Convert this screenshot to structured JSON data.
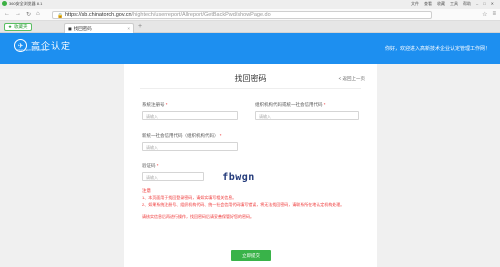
{
  "browser": {
    "window_title": "360安全浏览器 8.1",
    "menu": [
      "文件",
      "查看",
      "收藏",
      "工具",
      "帮助"
    ],
    "url_host": "https://sb.chinatorch.gov.cn",
    "url_path": "/hightech/userreport/Allreport/GetBackPwd/showPage.do",
    "favorites_label": "收藏夹",
    "tab_label": "找回密码"
  },
  "header": {
    "logo_text": "高企认定",
    "logo_sub": "HIGH-TECH ENTERPRISE",
    "welcome": "你好，欢迎进入高新技术企业认定管理工作网！"
  },
  "form": {
    "title": "找回密码",
    "back_link": "< 返回上一页",
    "fields": {
      "reg_no": {
        "label": "系统注册号",
        "placeholder": "请输入"
      },
      "org_code": {
        "label": "组织机构代码或统一社会信用代码",
        "placeholder": "请输入"
      },
      "new_code": {
        "label": "新统一社会信用代码（组织机构代码）",
        "placeholder": "请输入"
      },
      "captcha": {
        "label": "验证码",
        "placeholder": "请输入"
      }
    },
    "captcha_text": "fbwgn",
    "note_title": "注意",
    "notes": [
      "1、本页面用于找回登录密码，请如实填写相关信息。",
      "2、如果系统注册号、组织机构代码、统一社会信用代码填写错误，将无法找回密码，请联系所在地认定机构处理。",
      "请核实信息后再进行操作，找回密码后请妥善保管好您的密码。"
    ],
    "submit_label": "立即提交"
  }
}
